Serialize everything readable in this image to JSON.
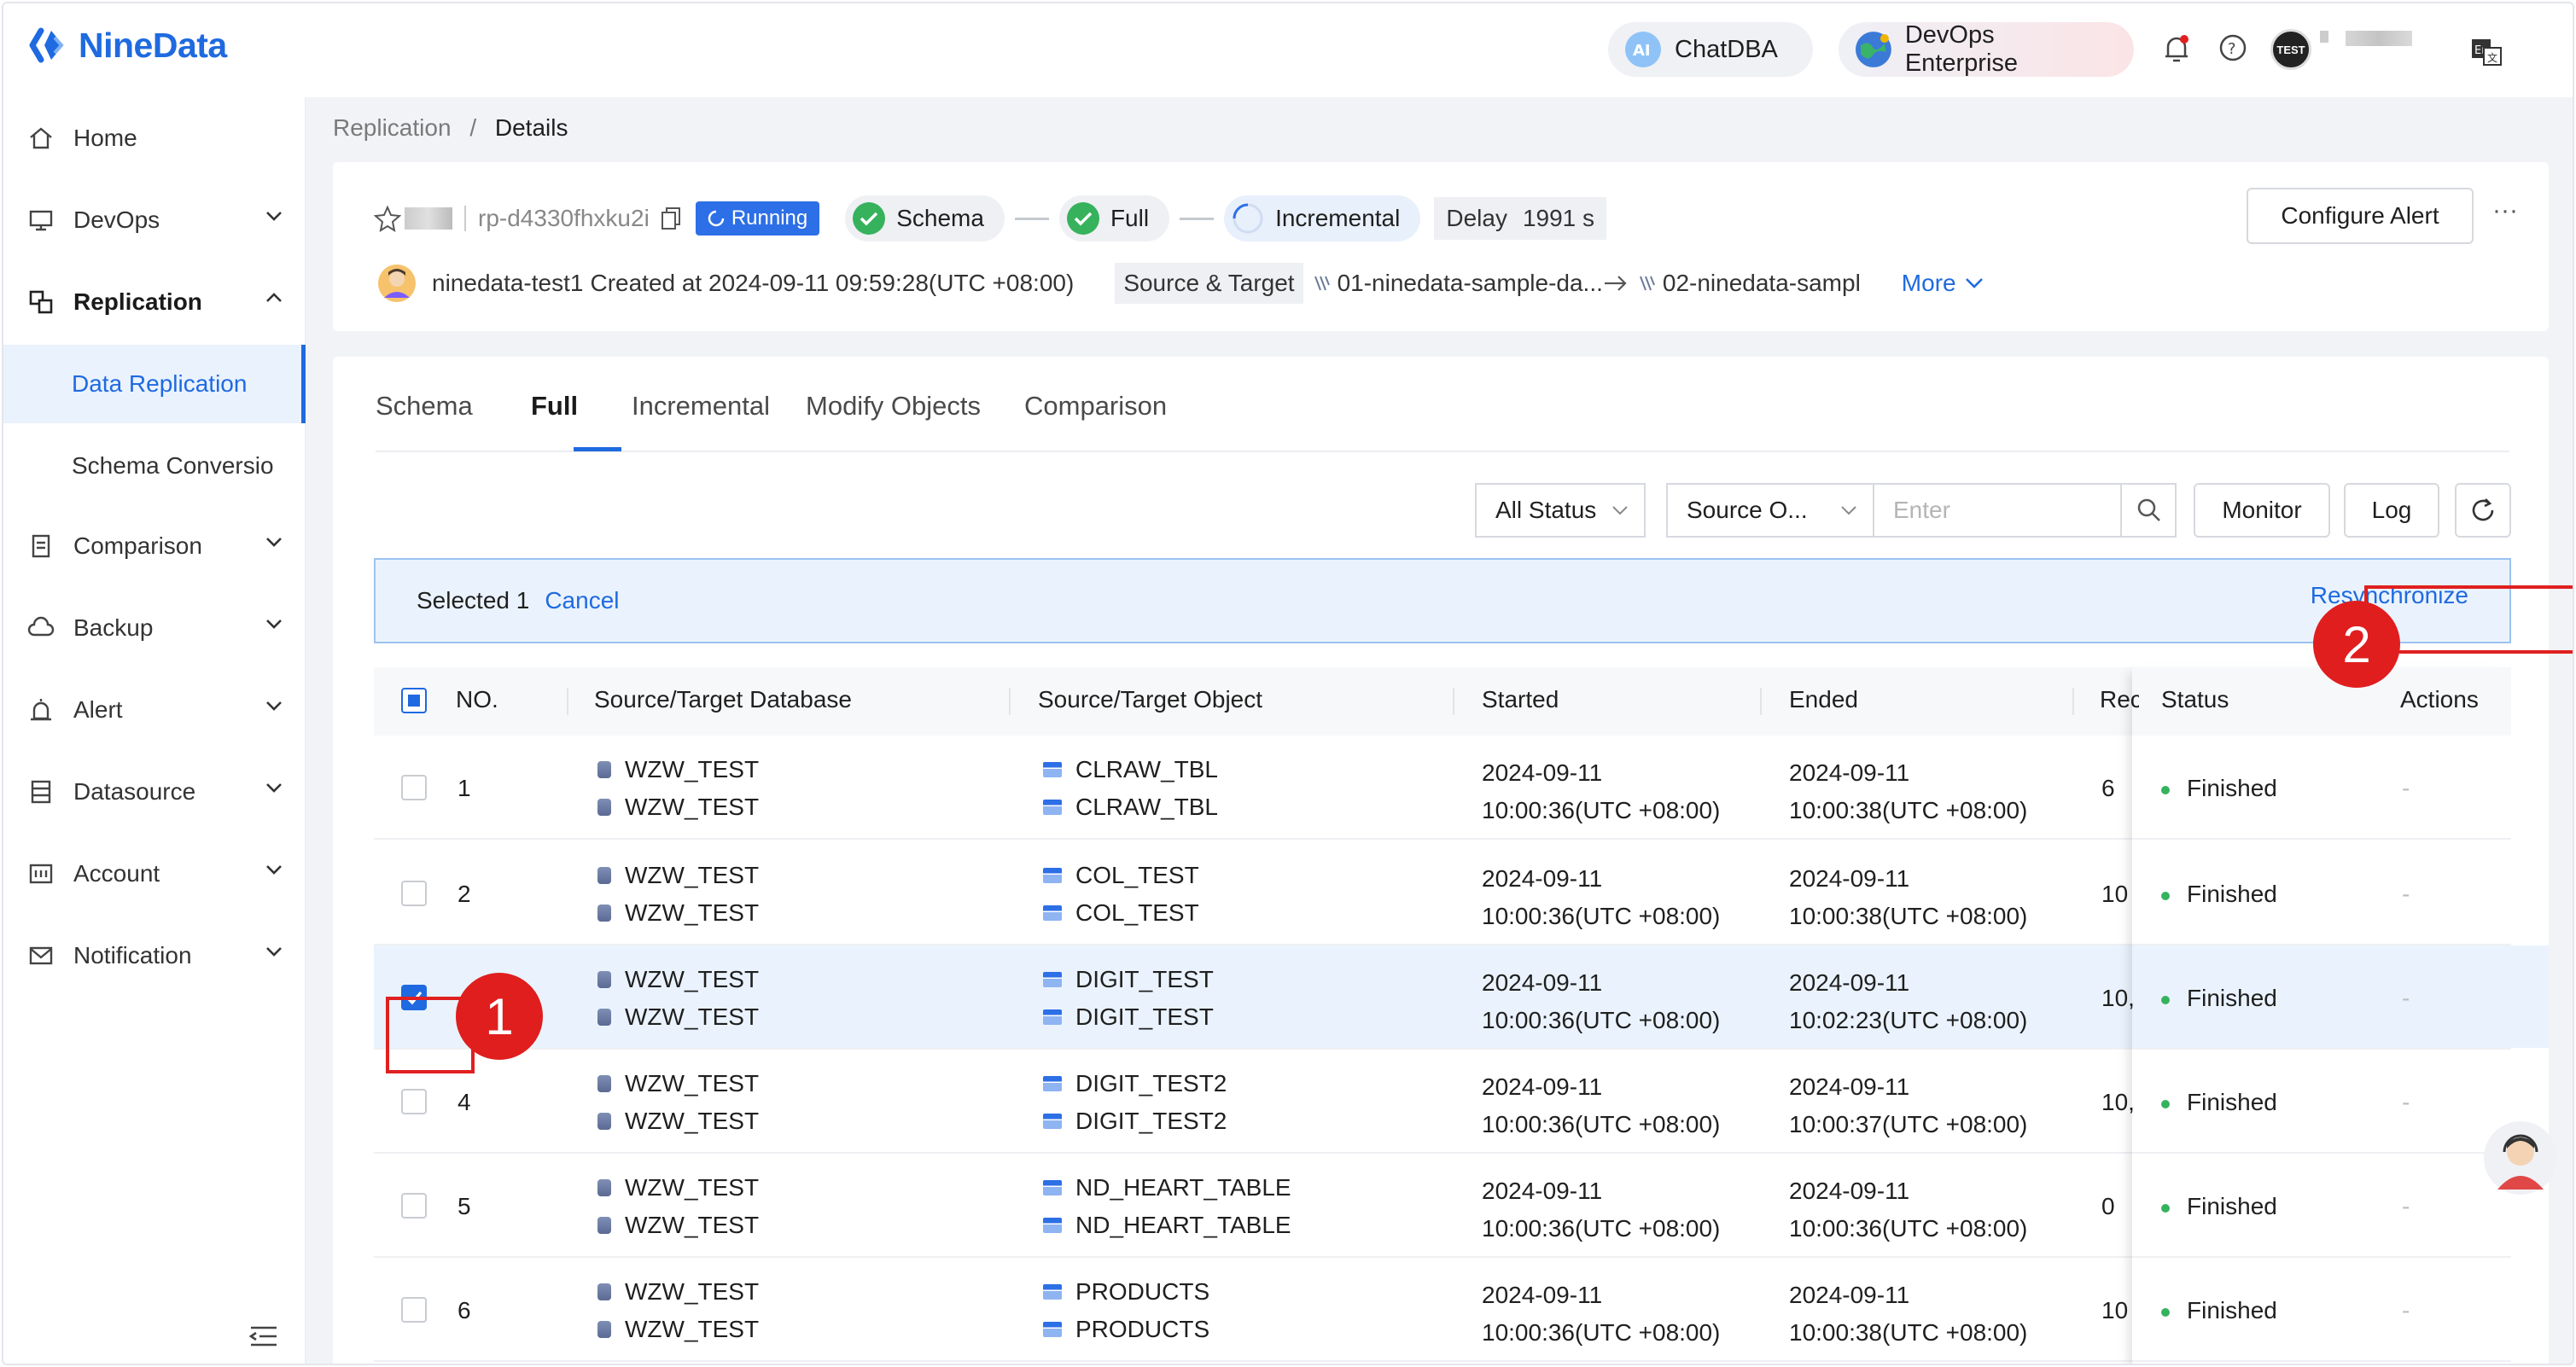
{
  "header": {
    "brand": "NineData",
    "chatdba_label": "ChatDBA",
    "devops_label": "DevOps Enterprise",
    "user_avatar_text": "TEST"
  },
  "sidebar": {
    "items": [
      {
        "label": "Home"
      },
      {
        "label": "DevOps"
      },
      {
        "label": "Replication"
      },
      {
        "label": "Comparison"
      },
      {
        "label": "Backup"
      },
      {
        "label": "Alert"
      },
      {
        "label": "Datasource"
      },
      {
        "label": "Account"
      },
      {
        "label": "Notification"
      }
    ],
    "sub_items": [
      {
        "label": "Data Replication"
      },
      {
        "label": "Schema Conversio"
      }
    ]
  },
  "breadcrumb": {
    "parent": "Replication",
    "separator": "/",
    "current": "Details"
  },
  "task": {
    "id": "rp-d4330fhxku2i",
    "state": "Running",
    "stages": [
      "Schema",
      "Full",
      "Incremental"
    ],
    "delay_label": "Delay",
    "delay_value": "1991 s",
    "owner": "ninedata-test1",
    "created": "Created at 2024-09-11 09:59:28(UTC +08:00)",
    "source_target_label": "Source & Target",
    "source": "01-ninedata-sample-da...",
    "target": "02-ninedata-sampl",
    "more_label": "More",
    "configure_alert_label": "Configure Alert",
    "overflow_label": "···"
  },
  "tabs": [
    "Schema",
    "Full",
    "Incremental",
    "Modify Objects",
    "Comparison"
  ],
  "active_tab": "Full",
  "filters": {
    "status": "All Status",
    "source_object": "Source O...",
    "search_placeholder": "Enter",
    "monitor_label": "Monitor",
    "log_label": "Log"
  },
  "selection": {
    "text": "Selected 1",
    "cancel_label": "Cancel",
    "resync_label": "Resynchronize"
  },
  "table": {
    "columns": [
      "NO.",
      "Source/Target Database",
      "Source/Target Object",
      "Started",
      "Ended",
      "Rec",
      "Status",
      "Actions"
    ],
    "rows": [
      {
        "no": "1",
        "db1": "WZW_TEST",
        "db2": "WZW_TEST",
        "obj1": "CLRAW_TBL",
        "obj2": "CLRAW_TBL",
        "start_date": "2024-09-11",
        "start_time": "10:00:36(UTC +08:00)",
        "end_date": "2024-09-11",
        "end_time": "10:00:38(UTC +08:00)",
        "rec": "6",
        "status": "Finished",
        "action": "-"
      },
      {
        "no": "2",
        "db1": "WZW_TEST",
        "db2": "WZW_TEST",
        "obj1": "COL_TEST",
        "obj2": "COL_TEST",
        "start_date": "2024-09-11",
        "start_time": "10:00:36(UTC +08:00)",
        "end_date": "2024-09-11",
        "end_time": "10:00:38(UTC +08:00)",
        "rec": "10",
        "status": "Finished",
        "action": "-"
      },
      {
        "no": "",
        "db1": "WZW_TEST",
        "db2": "WZW_TEST",
        "obj1": "DIGIT_TEST",
        "obj2": "DIGIT_TEST",
        "start_date": "2024-09-11",
        "start_time": "10:00:36(UTC +08:00)",
        "end_date": "2024-09-11",
        "end_time": "10:02:23(UTC +08:00)",
        "rec": "10,",
        "status": "Finished",
        "action": "-"
      },
      {
        "no": "4",
        "db1": "WZW_TEST",
        "db2": "WZW_TEST",
        "obj1": "DIGIT_TEST2",
        "obj2": "DIGIT_TEST2",
        "start_date": "2024-09-11",
        "start_time": "10:00:36(UTC +08:00)",
        "end_date": "2024-09-11",
        "end_time": "10:00:37(UTC +08:00)",
        "rec": "10,",
        "status": "Finished",
        "action": "-"
      },
      {
        "no": "5",
        "db1": "WZW_TEST",
        "db2": "WZW_TEST",
        "obj1": "ND_HEART_TABLE",
        "obj2": "ND_HEART_TABLE",
        "start_date": "2024-09-11",
        "start_time": "10:00:36(UTC +08:00)",
        "end_date": "2024-09-11",
        "end_time": "10:00:36(UTC +08:00)",
        "rec": "0",
        "status": "Finished",
        "action": "-"
      },
      {
        "no": "6",
        "db1": "WZW_TEST",
        "db2": "WZW_TEST",
        "obj1": "PRODUCTS",
        "obj2": "PRODUCTS",
        "start_date": "2024-09-11",
        "start_time": "10:00:36(UTC +08:00)",
        "end_date": "2024-09-11",
        "end_time": "10:00:38(UTC +08:00)",
        "rec": "10",
        "status": "Finished",
        "action": "-"
      }
    ]
  },
  "annotations": [
    "1",
    "2"
  ],
  "colors": {
    "accent": "#1f6ae0",
    "success": "#36b25d",
    "annotation": "#e01e1e"
  }
}
